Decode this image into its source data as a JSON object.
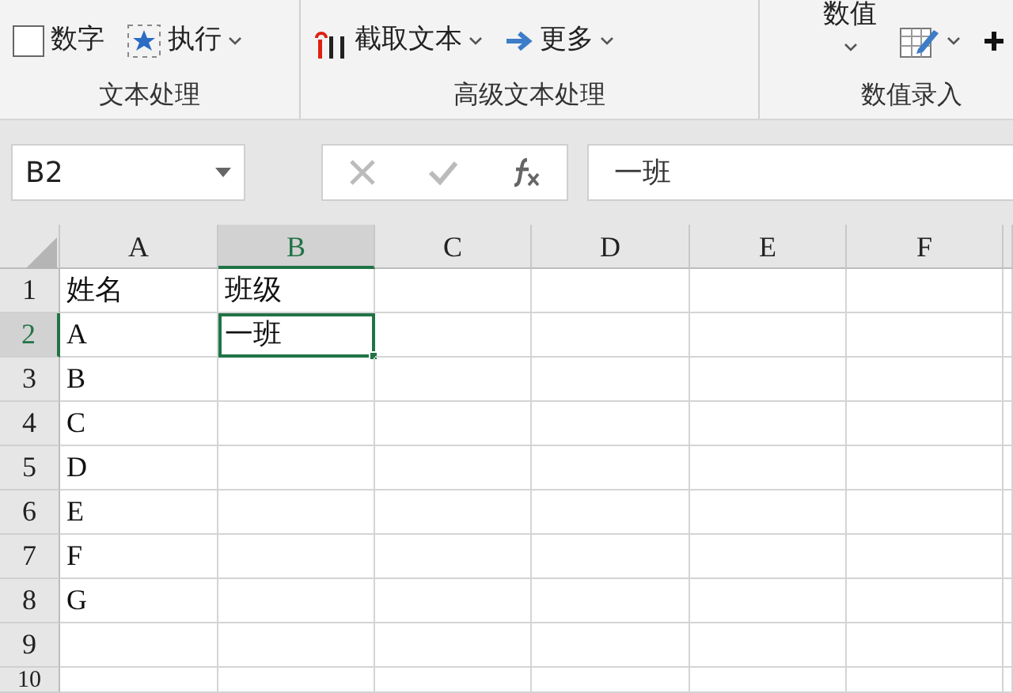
{
  "ribbon": {
    "groups": [
      {
        "label": "文本处理",
        "items": [
          {
            "kind": "checkbox",
            "label": "数字",
            "checked": false
          },
          {
            "kind": "menu",
            "label": "执行"
          }
        ]
      },
      {
        "label": "高级文本处理",
        "items": [
          {
            "kind": "menu",
            "label": "截取文本"
          },
          {
            "kind": "menu",
            "label": "更多"
          }
        ]
      },
      {
        "label": "数值录入",
        "items": [
          {
            "kind": "menu-below",
            "label": "数值"
          },
          {
            "kind": "icon-menu"
          },
          {
            "kind": "icon"
          }
        ]
      }
    ]
  },
  "formula_bar": {
    "name_box": "B2",
    "formula": "一班"
  },
  "columns": [
    {
      "label": "A",
      "selected": false
    },
    {
      "label": "B",
      "selected": true
    },
    {
      "label": "C",
      "selected": false
    },
    {
      "label": "D",
      "selected": false
    },
    {
      "label": "E",
      "selected": false
    },
    {
      "label": "F",
      "selected": false
    }
  ],
  "rows": [
    {
      "label": "1",
      "selected": false,
      "cells": [
        {
          "text": "姓名",
          "selected": false
        },
        {
          "text": "班级",
          "selected": false
        }
      ]
    },
    {
      "label": "2",
      "selected": true,
      "cells": [
        {
          "text": "A",
          "selected": false
        },
        {
          "text": "一班",
          "selected": true
        }
      ]
    },
    {
      "label": "3",
      "selected": false,
      "cells": [
        {
          "text": "B",
          "selected": false
        }
      ]
    },
    {
      "label": "4",
      "selected": false,
      "cells": [
        {
          "text": "C",
          "selected": false
        }
      ]
    },
    {
      "label": "5",
      "selected": false,
      "cells": [
        {
          "text": "D",
          "selected": false
        }
      ]
    },
    {
      "label": "6",
      "selected": false,
      "cells": [
        {
          "text": "E",
          "selected": false
        }
      ]
    },
    {
      "label": "7",
      "selected": false,
      "cells": [
        {
          "text": "F",
          "selected": false
        }
      ]
    },
    {
      "label": "8",
      "selected": false,
      "cells": [
        {
          "text": "G",
          "selected": false
        }
      ]
    },
    {
      "label": "9",
      "selected": false
    },
    {
      "label": "10",
      "selected": false
    }
  ]
}
